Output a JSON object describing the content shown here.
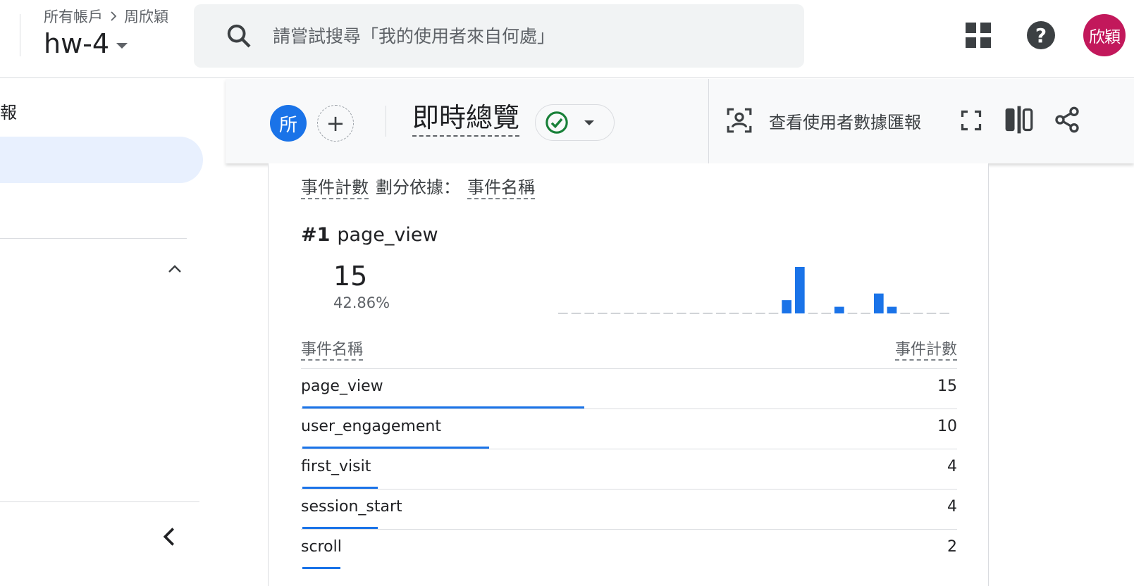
{
  "header": {
    "breadcrumb_account": "所有帳戶",
    "breadcrumb_user": "周欣穎",
    "property": "hw-4",
    "search_placeholder": "請嘗試搜尋「我的使用者來自何處」",
    "avatar_text": "欣穎",
    "help_text": "?"
  },
  "sidebar": {
    "item_text": "報"
  },
  "report": {
    "segment_chip": "所",
    "add_segment": "+",
    "title": "即時總覽",
    "view_user_snapshot": "查看使用者數據匯報",
    "status_color": "#188038"
  },
  "card": {
    "metric": "事件計數",
    "dimension_prefix": "劃分依據：",
    "dimension": "事件名稱",
    "top_rank": "#1",
    "top_name": "page_view",
    "top_value": "15",
    "top_percent": "42.86%",
    "col_name": "事件名稱",
    "col_count": "事件計數",
    "accent_color": "#1a73e8",
    "rows": [
      {
        "name": "page_view",
        "count": "15",
        "share": 0.43
      },
      {
        "name": "user_engagement",
        "count": "10",
        "share": 0.285
      },
      {
        "name": "first_visit",
        "count": "4",
        "share": 0.115
      },
      {
        "name": "session_start",
        "count": "4",
        "share": 0.115
      },
      {
        "name": "scroll",
        "count": "2",
        "share": 0.058
      }
    ]
  },
  "chart_data": {
    "type": "bar",
    "title": "",
    "xlabel": "",
    "ylabel": "",
    "values": [
      0,
      0,
      0,
      0,
      0,
      0,
      0,
      0,
      0,
      0,
      0,
      0,
      0,
      0,
      0,
      0,
      0,
      2,
      7,
      0,
      0,
      1,
      0,
      0,
      3,
      1,
      0,
      0,
      0,
      0
    ]
  }
}
